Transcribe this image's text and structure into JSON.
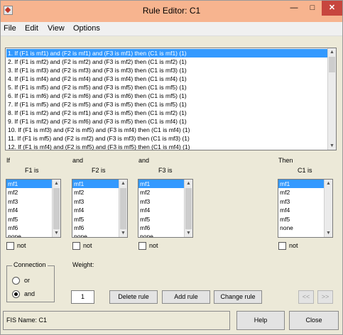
{
  "window": {
    "title": "Rule Editor: C1"
  },
  "menu": [
    "File",
    "Edit",
    "View",
    "Options"
  ],
  "rules": [
    "1. If (F1 is mf1) and (F2 is mf1) and (F3 is mf1) then (C1 is mf1) (1)",
    "2. If (F1 is mf2) and (F2 is mf2) and (F3 is mf2) then (C1 is mf2) (1)",
    "3. If (F1 is mf3) and (F2 is mf3) and (F3 is mf3) then (C1 is mf3) (1)",
    "4. If (F1 is mf4) and (F2 is mf4) and (F3 is mf4) then (C1 is mf4) (1)",
    "5. If (F1 is mf5) and (F2 is mf5) and (F3 is mf5) then (C1 is mf5) (1)",
    "6. If (F1 is mf6) and (F2 is mf6) and (F3 is mf6) then (C1 is mf5) (1)",
    "7. If (F1 is mf5) and (F2 is mf5) and (F3 is mf5) then (C1 is mf5) (1)",
    "8. If (F1 is mf2) and (F2 is mf1) and (F3 is mf5) then (C1 is mf2) (1)",
    "9. If (F1 is mf2) and (F2 is mf6) and (F3 is mf5) then (C1 is mf4) (1)",
    "10. If (F1 is mf3) and (F2 is mf5) and (F3 is mf4) then (C1 is mf4) (1)",
    "11. If (F1 is mf5) and (F2 is mf2) and (F3 is mf3) then (C1 is mf3) (1)",
    "12. If (F1 is mf4) and (F2 is mf5) and (F3 is mf5) then (C1 is mf4) (1)"
  ],
  "inputs": [
    {
      "prefix": "If",
      "name": "F1 is",
      "items": [
        "mf1",
        "mf2",
        "mf3",
        "mf4",
        "mf5",
        "mf6",
        "none"
      ],
      "selected": "mf1",
      "not_label": "not"
    },
    {
      "prefix": "and",
      "name": "F2 is",
      "items": [
        "mf1",
        "mf2",
        "mf3",
        "mf4",
        "mf5",
        "mf6",
        "none"
      ],
      "selected": "mf1",
      "not_label": "not"
    },
    {
      "prefix": "and",
      "name": "F3 is",
      "items": [
        "mf1",
        "mf2",
        "mf3",
        "mf4",
        "mf5",
        "mf6",
        "none"
      ],
      "selected": "mf1",
      "not_label": "not"
    }
  ],
  "output": {
    "prefix": "Then",
    "name": "C1 is",
    "items": [
      "mf1",
      "mf2",
      "mf3",
      "mf4",
      "mf5",
      "none"
    ],
    "selected": "mf1",
    "not_label": "not"
  },
  "connection": {
    "title": "Connection",
    "or_label": "or",
    "and_label": "and",
    "selected": "and"
  },
  "weight": {
    "label": "Weight:",
    "value": "1"
  },
  "buttons": {
    "delete": "Delete rule",
    "add": "Add rule",
    "change": "Change rule",
    "prev": "<<",
    "next": ">>"
  },
  "status": {
    "fis_name": "FIS Name: C1"
  },
  "bottom_buttons": {
    "help": "Help",
    "close": "Close"
  },
  "colors": {
    "title_bar": "#f7b48f",
    "selection": "#3399ff",
    "close_button": "#c7463e"
  }
}
